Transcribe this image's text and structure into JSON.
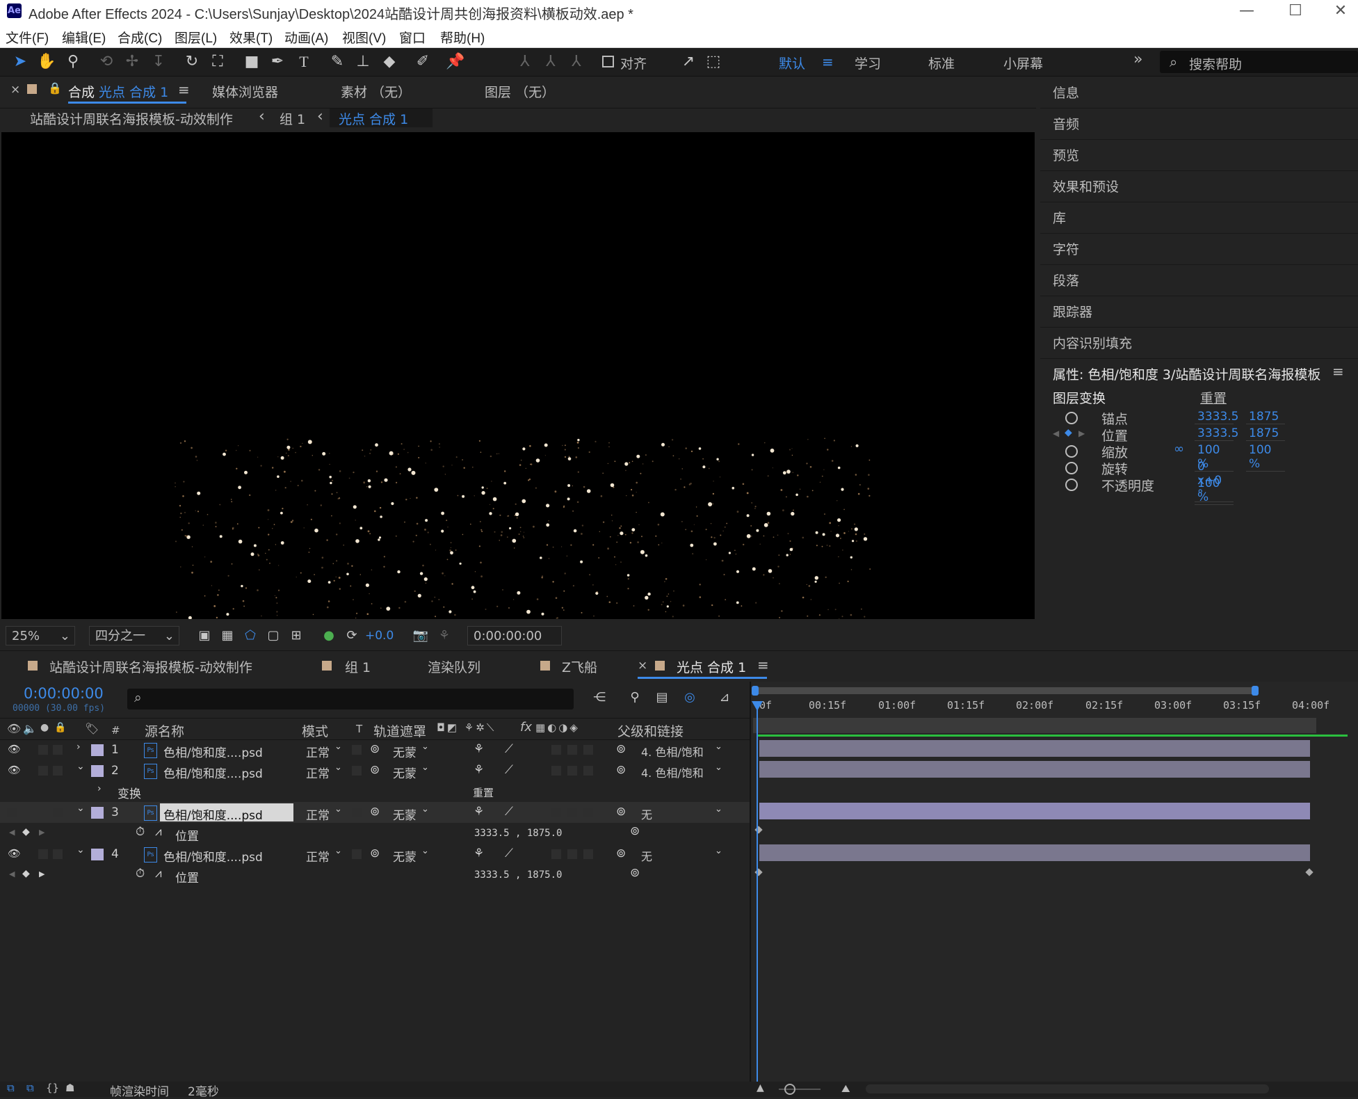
{
  "app": {
    "title": "Adobe After Effects 2024 - C:\\Users\\Sunjay\\Desktop\\2024站酷设计周共创海报资料\\横板动效.aep *",
    "logo": "Ae",
    "minimize_icon": "—",
    "maximize_icon": "☐",
    "close_icon": "✕"
  },
  "menu": [
    "文件(F)",
    "编辑(E)",
    "合成(C)",
    "图层(L)",
    "效果(T)",
    "动画(A)",
    "视图(V)",
    "窗口",
    "帮助(H)"
  ],
  "toolbar": {
    "align_label": "对齐",
    "workspaces": [
      "默认",
      "学习",
      "标准",
      "小屏幕"
    ],
    "active_workspace": "默认",
    "menu_icon": "≡",
    "more_icon": "»",
    "search_placeholder": "搜索帮助",
    "accent": "#3d8ae8"
  },
  "comp_panel": {
    "close_icon": "×",
    "tab_prefix": "合成",
    "tab_name": "光点 合成 1",
    "menu_icon": "≡",
    "other_tabs": [
      "媒体浏览器",
      "素材 （无）",
      "图层 （无）"
    ],
    "breadcrumb": [
      "站酷设计周联名海报模板-动效制作",
      "组 1",
      "光点 合成 1"
    ],
    "breadcrumb_sep": "‹",
    "zoom": "25%",
    "resolution": "四分之一",
    "exposure": "+0.0",
    "timecode": "0:00:00:00"
  },
  "right_panel": {
    "items": [
      "信息",
      "音频",
      "预览",
      "效果和预设",
      "库",
      "字符",
      "段落",
      "跟踪器",
      "内容识别填充"
    ],
    "properties_title": "属性: 色相/饱和度 3/站酷设计周联名海报模板",
    "menu_icon": "≡",
    "layer_transform": "图层变换",
    "reset": "重置",
    "props": [
      {
        "label": "锚点",
        "v1": "3333.5",
        "v2": "1875"
      },
      {
        "label": "位置",
        "v1": "3333.5",
        "v2": "1875"
      },
      {
        "label": "缩放",
        "v1": "100 %",
        "v2": "100 %"
      },
      {
        "label": "旋转",
        "v1": "0 x+0 °",
        "v2": ""
      },
      {
        "label": "不透明度",
        "v1": "100 %",
        "v2": ""
      }
    ],
    "link_icon": "∞"
  },
  "timeline": {
    "tabs": [
      "站酷设计周联名海报模板-动效制作",
      "组 1",
      "渲染队列",
      "Z飞船",
      "光点 合成 1"
    ],
    "close_icon": "×",
    "menu_icon": "≡",
    "current_time": "0:00:00:00",
    "frames": "00000 (30.00 fps)",
    "search_icon": "⌕",
    "headers": {
      "num": "#",
      "source": "源名称",
      "mode": "模式",
      "t": "T",
      "track_matte": "轨道遮罩",
      "fx": "fx",
      "parent": "父级和链接"
    },
    "ruler": [
      "0f",
      "00:15f",
      "01:00f",
      "01:15f",
      "02:00f",
      "02:15f",
      "03:00f",
      "03:15f",
      "04:00f"
    ],
    "layers": [
      {
        "num": "1",
        "name": "色相/饱和度....psd",
        "mode": "正常",
        "matte": "无蒙",
        "parent": "4. 色相/饱和"
      },
      {
        "num": "2",
        "name": "色相/饱和度....psd",
        "mode": "正常",
        "matte": "无蒙",
        "parent": "4. 色相/饱和"
      },
      {
        "num": "3",
        "name": "色相/饱和度....psd",
        "mode": "正常",
        "matte": "无蒙",
        "parent": "无"
      },
      {
        "num": "4",
        "name": "色相/饱和度....psd",
        "mode": "正常",
        "matte": "无蒙",
        "parent": "无"
      }
    ],
    "transform_label": "变换",
    "reset": "重置",
    "position_label": "位置",
    "position_value": "3333.5 , 1875.0",
    "bar_color": "#7a778e",
    "selected_bar_color": "#8e89b5",
    "work_area_color": "#2bbf3f",
    "playhead_color": "#3d8ae8"
  },
  "status": {
    "render_time_label": "帧渲染时间",
    "render_time_value": "2毫秒"
  }
}
